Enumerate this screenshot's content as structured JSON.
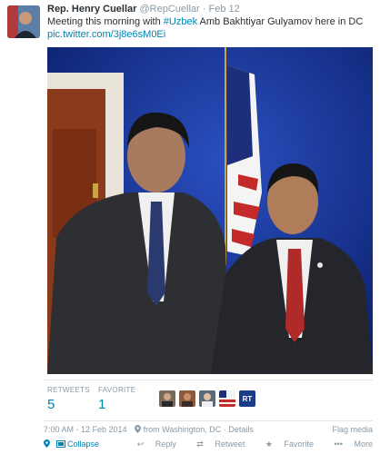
{
  "tweet": {
    "author_name": "Rep. Henry Cuellar",
    "handle": "@RepCuellar",
    "separator": "·",
    "date": "Feb 12",
    "text_part1": "Meeting this morning with ",
    "hashtag": "#Uzbek",
    "text_part2": " Amb Bakhtiyar Gulyamov here in DC",
    "link": "pic.twitter.com/3j8e6sM0Ei"
  },
  "stats": {
    "retweets_label": "RETWEETS",
    "retweets_value": "5",
    "favorites_label": "FAVORITE",
    "favorites_value": "1",
    "rt_badge": "RT"
  },
  "meta": {
    "timestamp": "7:00 AM - 12 Feb 2014",
    "location": "from Washington, DC",
    "details": "Details",
    "flag_media": "Flag media"
  },
  "actions": {
    "collapse": "Collapse",
    "reply": "Reply",
    "retweet": "Retweet",
    "favorite": "Favorite",
    "more": "More"
  },
  "colors": {
    "link": "#0084b4",
    "muted": "#8899a6",
    "text": "#292f33",
    "photo_background": "#0f2a7e"
  },
  "icons": [
    "pin-icon",
    "collapse-icon",
    "reply-icon",
    "retweet-icon",
    "favorite-star-icon",
    "more-dots-icon"
  ]
}
